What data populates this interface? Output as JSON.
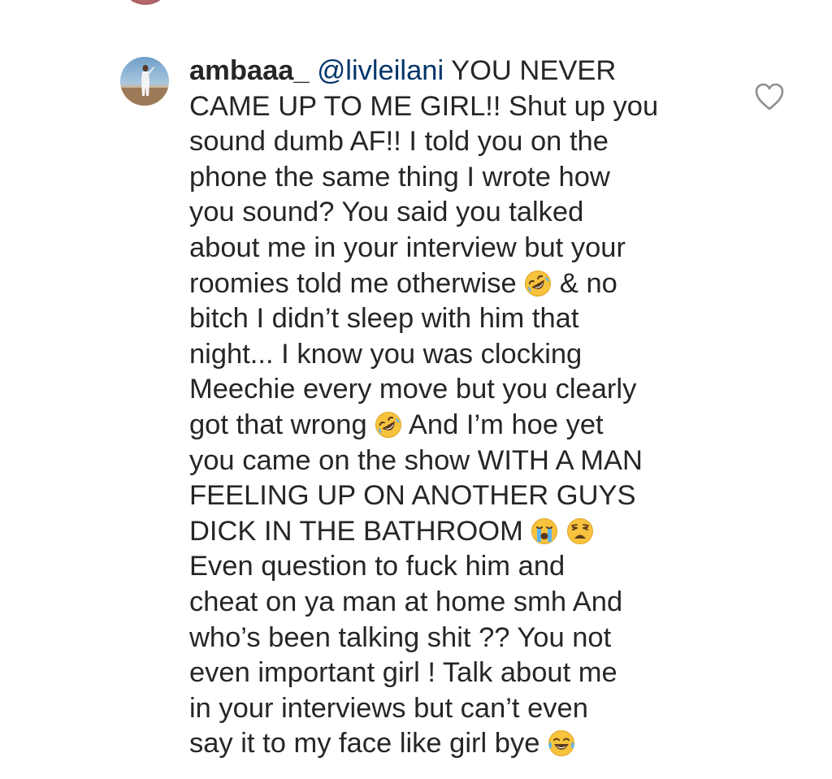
{
  "comment": {
    "username": "ambaaa_",
    "mention": "@livleilani",
    "lines": [
      " YOU NEVER",
      "CAME UP TO ME GIRL!! Shut up you",
      "sound dumb AF!! I told you on the",
      "phone the same thing I wrote how",
      "you sound? You said you talked",
      "about me in your interview but your",
      "roomies told me otherwise",
      "& no",
      "bitch I didn’t sleep with him that",
      "night... I know you was clocking",
      "Meechie every move but you clearly",
      "got that wrong",
      "And I’m hoe yet",
      "you came on the show WITH A MAN",
      "FEELING UP ON ANOTHER GUYS",
      "DICK IN THE BATHROOM",
      "Even question to fuck him and",
      "cheat on ya man at home smh And",
      "who’s been talking shit ?? You not",
      "even important girl ! Talk about me",
      "in your interviews but can’t even",
      "say it to my face like girl bye"
    ],
    "emojis": {
      "rofl": "rolling-on-floor-laughing-emoji",
      "crying": "loudly-crying-emoji",
      "weary": "weary-face-emoji",
      "tears_of_joy": "face-with-tears-of-joy-emoji"
    }
  },
  "icons": {
    "like": "heart-outline-icon"
  },
  "colors": {
    "text": "#262626",
    "mention": "#003569",
    "icon": "#8e8e8e",
    "emoji_yellow": "#f7c23c"
  }
}
